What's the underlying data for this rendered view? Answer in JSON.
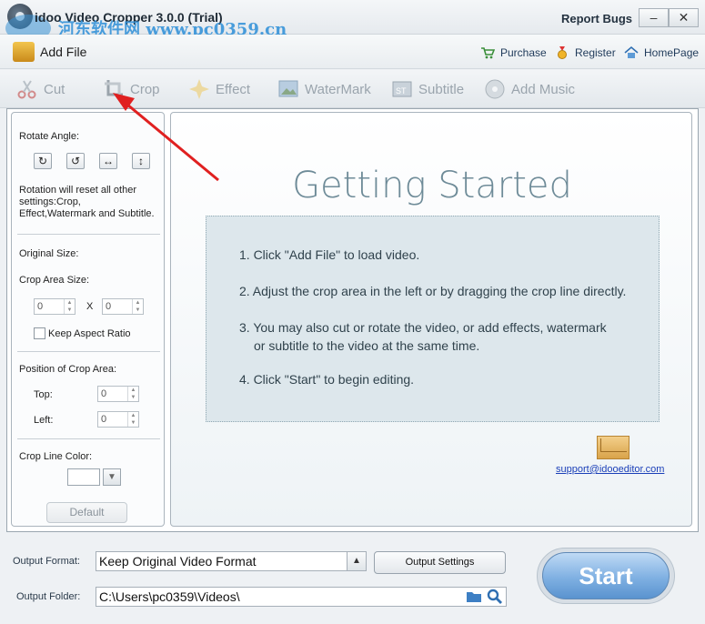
{
  "window": {
    "title": "idoo Video Cropper 3.0.0 (Trial)",
    "watermark_text": "河东软件网 www.pc0359.cn",
    "report_bugs": "Report Bugs",
    "minimize": "–",
    "close": "✕"
  },
  "toolbar": {
    "add_file": "Add File",
    "purchase": "Purchase",
    "register": "Register",
    "homepage": "HomePage"
  },
  "tools": {
    "cut": "Cut",
    "crop": "Crop",
    "effect": "Effect",
    "watermark": "WaterMark",
    "subtitle": "Subtitle",
    "add_music": "Add Music"
  },
  "left_panel": {
    "rotate_angle": "Rotate Angle:",
    "rotate_note": [
      "Rotation will reset all other",
      "settings:Crop,",
      "Effect,Watermark and Subtitle."
    ],
    "original_size": "Original Size:",
    "crop_area_size": "Crop Area Size:",
    "width_value": "0",
    "x_sep": "X",
    "height_value": "0",
    "keep_aspect": "Keep Aspect Ratio",
    "position_title": "Position of Crop Area:",
    "top_label": "Top:",
    "top_value": "0",
    "left_label": "Left:",
    "left_value": "0",
    "crop_line_color": "Crop Line Color:",
    "default_button": "Default"
  },
  "getting_started": {
    "title": "Getting Started",
    "steps": [
      "1. Click \"Add File\" to load video.",
      "2. Adjust the crop area in the left or by dragging the crop line directly.",
      "3. You may also cut or rotate the video, or add effects, watermark",
      "or subtitle to the video at the same time.",
      "4. Click \"Start\" to begin editing."
    ],
    "support_email": "support@idooeditor.com"
  },
  "bottom": {
    "output_format_label": "Output Format:",
    "output_format_value": "Keep Original Video Format",
    "output_settings": "Output Settings",
    "output_folder_label": "Output Folder:",
    "output_folder_value": "C:\\Users\\pc0359\\Videos\\",
    "start": "Start"
  },
  "colors": {
    "accent": "#5a93cf",
    "disabled_text": "#9aa4ad",
    "link": "#1a3fb8",
    "annotation_arrow": "#e02020"
  }
}
